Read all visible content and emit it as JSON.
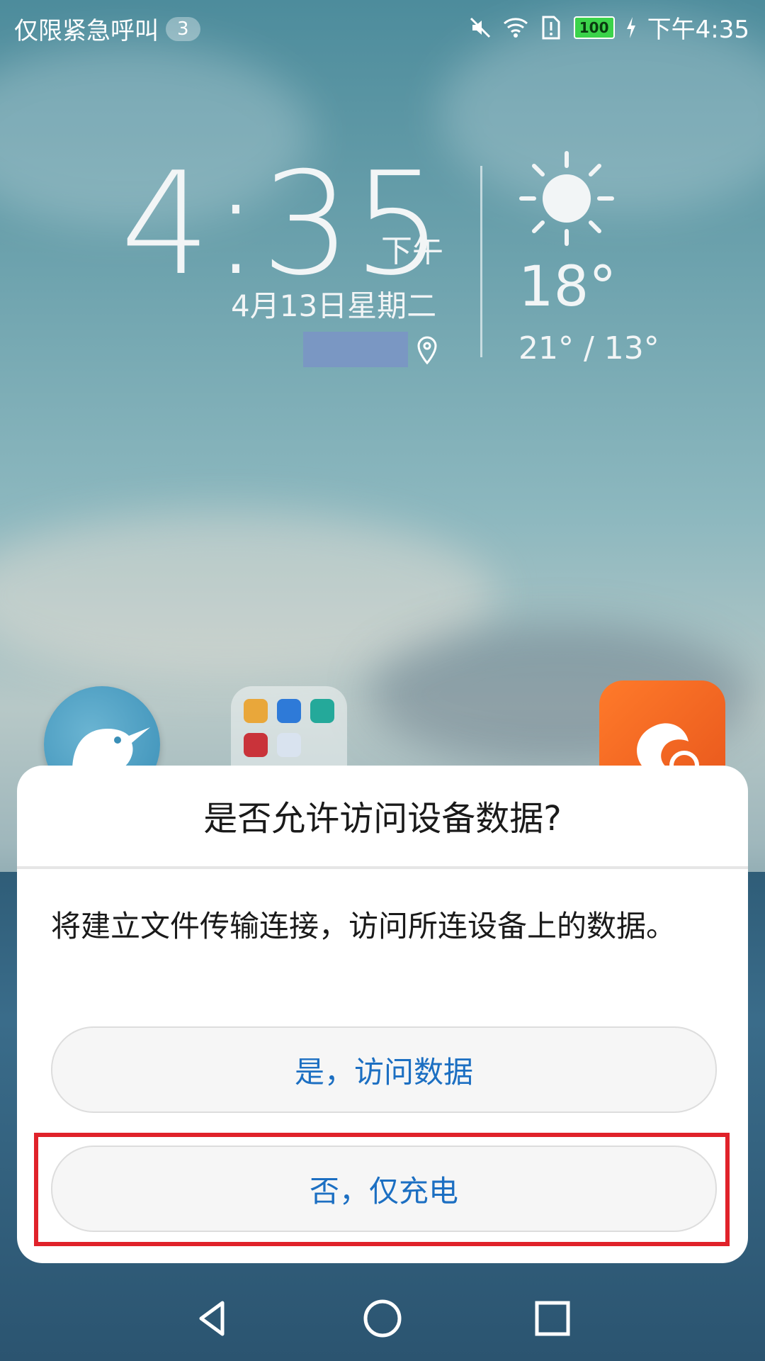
{
  "status_bar": {
    "carrier_text": "仅限紧急呼叫",
    "badge_count": "3",
    "battery_level": "100",
    "time": "下午4:35",
    "icons": [
      "mute-icon",
      "wifi-icon",
      "sim-alert-icon",
      "battery-icon",
      "charging-icon"
    ]
  },
  "clock_widget": {
    "time": "4:35",
    "ampm": "下午",
    "date": "4月13日星期二",
    "weather_icon": "sun-icon",
    "temperature": "18°",
    "range": "21° / 13°"
  },
  "home_apps": [
    {
      "name": "kiwi-app-icon"
    },
    {
      "name": "folder-icon"
    },
    {
      "name": "uc-browser-icon"
    }
  ],
  "dialog": {
    "title": "是否允许访问设备数据?",
    "message": "将建立文件传输连接，访问所连设备上的数据。",
    "yes_label": "是，访问数据",
    "no_label": "否，仅充电",
    "highlight_color": "#e0222a",
    "button_text_color": "#1c6fc2"
  },
  "nav_bar": {
    "buttons": [
      "back-icon",
      "home-icon",
      "recents-icon"
    ]
  }
}
